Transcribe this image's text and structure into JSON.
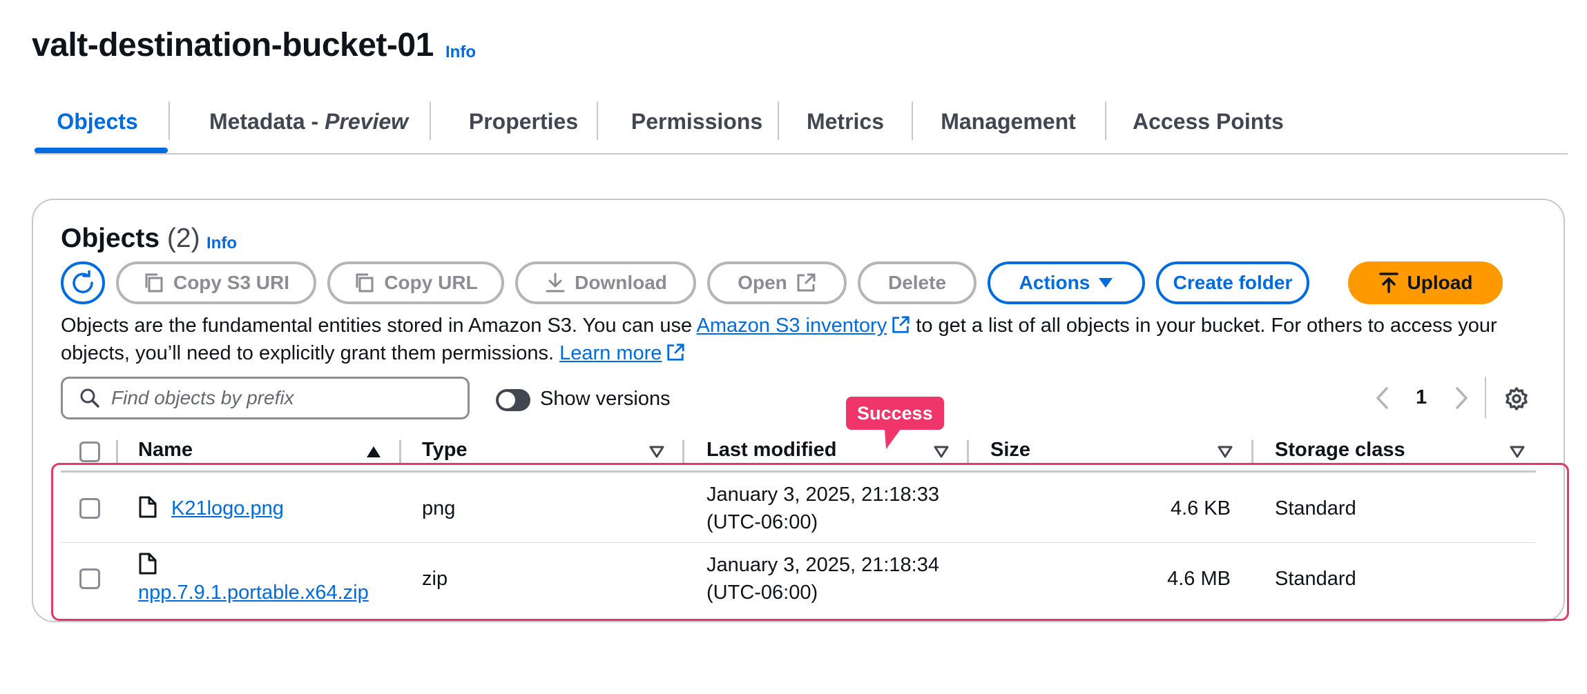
{
  "page": {
    "title": "valt-destination-bucket-01",
    "info_label": "Info"
  },
  "tabs": [
    {
      "label": "Objects",
      "active": true
    },
    {
      "label_main": "Metadata - ",
      "label_em": "Preview"
    },
    {
      "label": "Properties"
    },
    {
      "label": "Permissions"
    },
    {
      "label": "Metrics"
    },
    {
      "label": "Management"
    },
    {
      "label": "Access Points"
    }
  ],
  "objects_panel": {
    "heading": "Objects",
    "count": "(2)",
    "info_label": "Info",
    "buttons": {
      "copy_s3_uri": "Copy S3 URI",
      "copy_url": "Copy URL",
      "download": "Download",
      "open": "Open",
      "delete": "Delete",
      "actions": "Actions",
      "create_folder": "Create folder",
      "upload": "Upload"
    },
    "description": {
      "part1": "Objects are the fundamental entities stored in Amazon S3. You can use ",
      "link1": "Amazon S3 inventory",
      "part2": " to get a list of all objects in your bucket. For others to access your objects, you’ll need to explicitly grant them permissions. ",
      "link2": "Learn more"
    },
    "search": {
      "placeholder": "Find objects by prefix",
      "value": ""
    },
    "show_versions": {
      "label": "Show versions",
      "enabled": false
    },
    "pagination": {
      "current_page": "1"
    },
    "columns": {
      "name": "Name",
      "type": "Type",
      "last_modified": "Last modified",
      "size": "Size",
      "storage_class": "Storage class"
    },
    "rows": [
      {
        "name": "K21logo.png",
        "type": "png",
        "modified_date": "January 3, 2025, 21:18:33",
        "modified_tz": "(UTC-06:00)",
        "size": "4.6 KB",
        "storage_class": "Standard"
      },
      {
        "name": "npp.7.9.1.portable.x64.zip",
        "type": "zip",
        "modified_date": "January 3, 2025, 21:18:34",
        "modified_tz": "(UTC-06:00)",
        "size": "4.6 MB",
        "storage_class": "Standard"
      }
    ]
  },
  "annotation": {
    "tooltip": "Success",
    "highlight_color": "#e8366b"
  },
  "colors": {
    "accent": "#006ce0",
    "primary_button": "#ff9900",
    "disabled": "#8c8c94"
  }
}
